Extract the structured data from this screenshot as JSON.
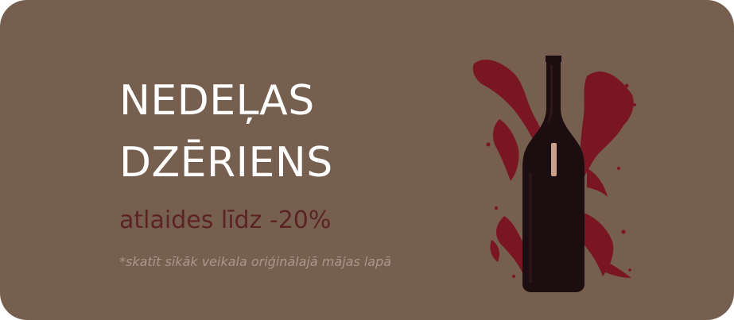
{
  "banner": {
    "headline_line1": "NEDEĻAS",
    "headline_line2": "DZĒRIENS",
    "discount_text": "atlaides līdz -20%",
    "footnote": "*skatīt sīkāk veikala oriģinālajā mājas lapā"
  },
  "colors": {
    "background": "#765f4f",
    "headline": "#ffffff",
    "discount": "#5c2323",
    "footnote": "#a8978c",
    "wine": "#7a1522",
    "bottle": "#1c0e10"
  },
  "image": {
    "subject": "wine-bottle-with-splash"
  }
}
